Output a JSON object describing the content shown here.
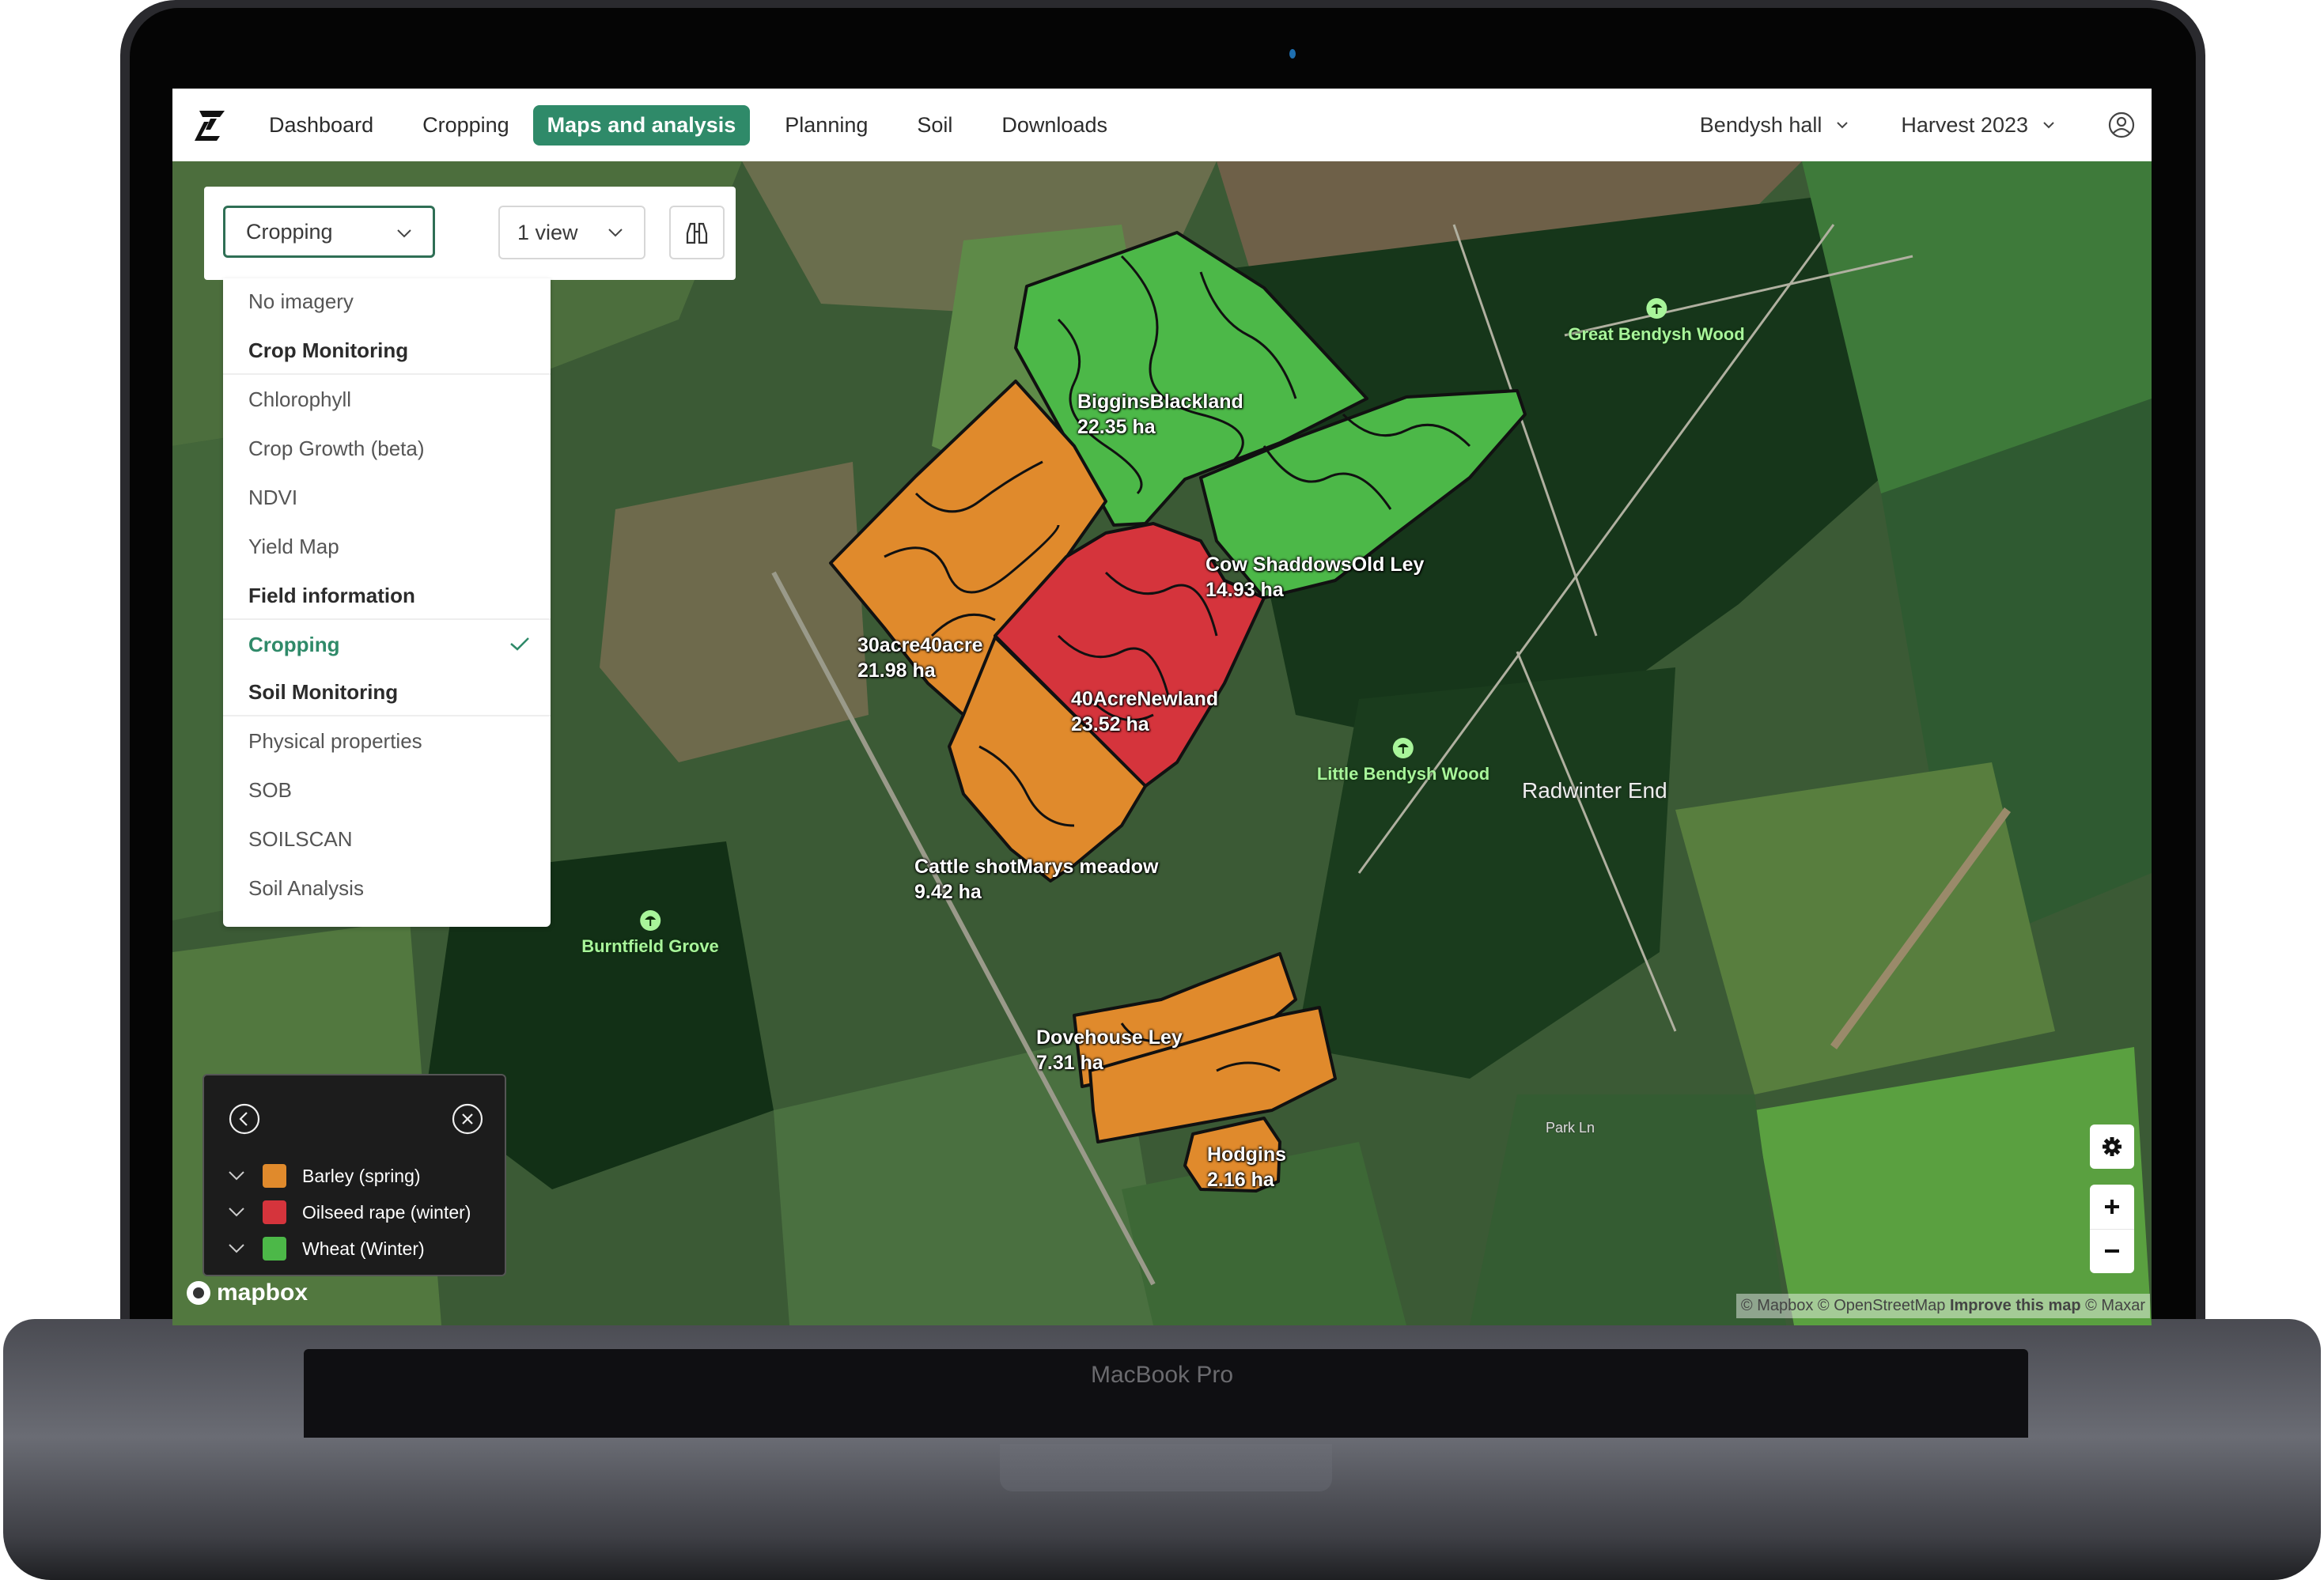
{
  "device": {
    "brand_label": "MacBook Pro"
  },
  "topbar": {
    "nav": [
      {
        "label": "Dashboard",
        "active": false
      },
      {
        "label": "Cropping",
        "active": false
      },
      {
        "label": "Maps and analysis",
        "active": true
      },
      {
        "label": "Planning",
        "active": false
      },
      {
        "label": "Soil",
        "active": false
      },
      {
        "label": "Downloads",
        "active": false
      }
    ],
    "farm_selector": "Bendysh hall",
    "season_selector": "Harvest 2023",
    "icons": {
      "logo": "z-logo-icon",
      "user": "user-circle-icon"
    }
  },
  "map_controls": {
    "layer_select": {
      "value": "Cropping",
      "open": true
    },
    "view_select": {
      "value": "1 view"
    },
    "compare_button": {
      "icon": "binoculars-icon"
    }
  },
  "layer_menu": {
    "items": [
      {
        "type": "option",
        "label": "No imagery"
      },
      {
        "type": "header",
        "label": "Crop Monitoring"
      },
      {
        "type": "option",
        "label": "Chlorophyll"
      },
      {
        "type": "option",
        "label": "Crop Growth (beta)"
      },
      {
        "type": "option",
        "label": "NDVI"
      },
      {
        "type": "option",
        "label": "Yield Map"
      },
      {
        "type": "header",
        "label": "Field information"
      },
      {
        "type": "option",
        "label": "Cropping",
        "selected": true
      },
      {
        "type": "header",
        "label": "Soil Monitoring"
      },
      {
        "type": "option",
        "label": "Physical properties"
      },
      {
        "type": "option",
        "label": "SOB"
      },
      {
        "type": "option",
        "label": "SOILSCAN"
      },
      {
        "type": "option",
        "label": "Soil Analysis"
      }
    ]
  },
  "legend": {
    "items": [
      {
        "label": "Barley (spring)",
        "color": "#e08a2c"
      },
      {
        "label": "Oilseed rape (winter)",
        "color": "#d5343c"
      },
      {
        "label": "Wheat (Winter)",
        "color": "#4cb848"
      }
    ]
  },
  "fields": [
    {
      "name": "BigginsBlackland",
      "area": "22.35 ha",
      "crop": "Wheat (Winter)"
    },
    {
      "name": "Cow ShaddowsOld Ley",
      "area": "14.93 ha",
      "crop": "Wheat (Winter)"
    },
    {
      "name": "30acre40acre",
      "area": "21.98 ha",
      "crop": "Barley (spring)"
    },
    {
      "name": "40AcreNewland",
      "area": "23.52 ha",
      "crop": "Oilseed rape (winter)"
    },
    {
      "name": "Cattle shotMarys meadow",
      "area": "9.42 ha",
      "crop": "Barley (spring)"
    },
    {
      "name": "Dovehouse Ley",
      "area": "7.31 ha",
      "crop": "Barley (spring)"
    },
    {
      "name": "Hodgins",
      "area": "2.16 ha",
      "crop": "Barley (spring)"
    }
  ],
  "map_labels": {
    "pois": [
      "Great Bendysh Wood",
      "Little Bendysh Wood",
      "Burntfield Grove"
    ],
    "places": [
      "Radwinter End"
    ],
    "roads": [
      "Park Ln"
    ]
  },
  "attribution": {
    "mapbox": "© Mapbox",
    "osm": "© OpenStreetMap",
    "improve": "Improve this map",
    "maxar": "© Maxar",
    "logo_text": "mapbox"
  },
  "colors": {
    "accent": "#2f8a69",
    "barley": "#e08a2c",
    "oilseed": "#d5343c",
    "wheat": "#4cb848",
    "poi_label": "#a8f59a"
  }
}
